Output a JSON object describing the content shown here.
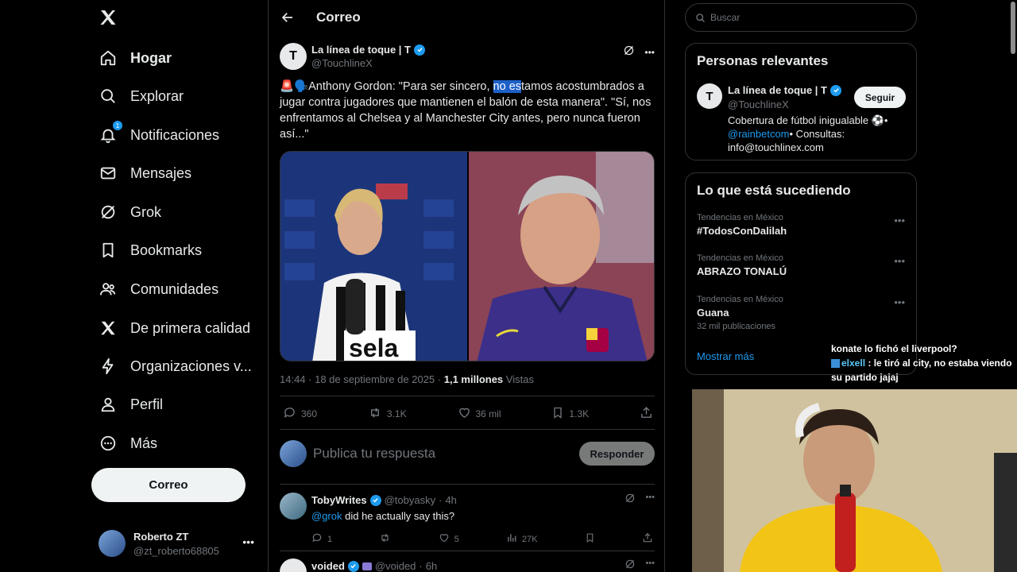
{
  "sidebar": {
    "items": [
      {
        "label": "Hogar",
        "icon": "home-icon"
      },
      {
        "label": "Explorar",
        "icon": "search-icon"
      },
      {
        "label": "Notificaciones",
        "icon": "bell-icon",
        "badge": "1"
      },
      {
        "label": "Mensajes",
        "icon": "mail-icon"
      },
      {
        "label": "Grok",
        "icon": "grok-icon"
      },
      {
        "label": "Bookmarks",
        "icon": "bookmark-icon"
      },
      {
        "label": "Comunidades",
        "icon": "people-icon"
      },
      {
        "label": "De primera calidad",
        "icon": "x-logo-icon"
      },
      {
        "label": "Organizaciones v...",
        "icon": "lightning-icon"
      },
      {
        "label": "Perfil",
        "icon": "person-icon"
      },
      {
        "label": "Más",
        "icon": "more-circle-icon"
      }
    ],
    "post_button": "Correo",
    "account": {
      "name": "Roberto ZT",
      "handle": "@zt_roberto68805"
    }
  },
  "main": {
    "title": "Correo",
    "tweet": {
      "author": "La línea de toque | T",
      "avatar_letter": "T",
      "handle": "@TouchlineX",
      "text_before": "🚨🗣️Anthony Gordon: \"Para ser sincero, ",
      "text_highlight": "no es",
      "text_after": "tamos acostumbrados a jugar contra jugadores que mantienen el balón de esta manera\". \"Sí, nos enfrentamos al Chelsea y al Manchester City antes, pero nunca fueron así...\"",
      "time": "14:44",
      "date": "18 de septiembre de 2025",
      "views": "1,1 millones",
      "views_label": "Vistas",
      "replies": "360",
      "retweets": "3.1K",
      "likes": "36 mil",
      "bookmarks": "1.3K"
    },
    "reply_box": {
      "placeholder": "Publica tu respuesta",
      "button": "Responder"
    },
    "replies": [
      {
        "name": "TobyWrites",
        "handle": "@tobyasky",
        "time": "4h",
        "mention": "@grok",
        "text": " did he actually say this?",
        "replies": "1",
        "likes": "5",
        "views": "27K"
      },
      {
        "name": "voided",
        "handle": "@voided",
        "time": "6h"
      }
    ]
  },
  "right": {
    "search_placeholder": "Buscar",
    "relevant": {
      "title": "Personas relevantes",
      "name": "La línea de toque | T",
      "avatar_letter": "T",
      "handle": "@TouchlineX",
      "follow": "Seguir",
      "bio_1": "Cobertura de fútbol inigualable ⚽•",
      "bio_mention": "@rainbetcom",
      "bio_2": "• Consultas: info@touchlinex.com"
    },
    "trends": {
      "title": "Lo que está sucediendo",
      "items": [
        {
          "context": "Tendencias en México",
          "name": "#TodosConDalilah"
        },
        {
          "context": "Tendencias en México",
          "name": "ABRAZO TONALÚ"
        },
        {
          "context": "Tendencias en México",
          "name": "Guana",
          "count": "32 mil publicaciones"
        }
      ],
      "show_more": "Mostrar más"
    }
  },
  "chat": {
    "line1": "konate lo fichó el liverpool?",
    "user": "elxell",
    "message": " : le tiró al city, no estaba viendo su partido jajaj"
  },
  "colors": {
    "accent": "#1d9bf0",
    "background": "#000000",
    "border": "#2f3336",
    "muted": "#71767b"
  }
}
